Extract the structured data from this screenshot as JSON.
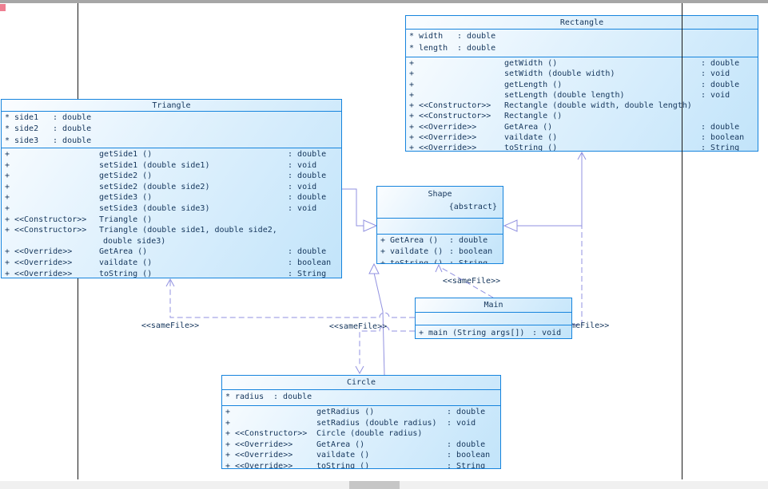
{
  "diagram": {
    "classes": [
      {
        "id": "rectangle",
        "title": "Rectangle",
        "attributes": [
          {
            "vis": "*",
            "name": "width",
            "type": "double"
          },
          {
            "vis": "*",
            "name": "length",
            "type": "double"
          }
        ],
        "methods": [
          {
            "vis": "+",
            "stereo": "",
            "name": "getWidth ()",
            "ret": "double"
          },
          {
            "vis": "+",
            "stereo": "",
            "name": "setWidth (double width)",
            "ret": "void"
          },
          {
            "vis": "+",
            "stereo": "",
            "name": "getLength ()",
            "ret": "double"
          },
          {
            "vis": "+",
            "stereo": "",
            "name": "setLength (double length)",
            "ret": "void"
          },
          {
            "vis": "+",
            "stereo": "<<Constructor>>",
            "name": "Rectangle (double width, double length)",
            "ret": ""
          },
          {
            "vis": "+",
            "stereo": "<<Constructor>>",
            "name": "Rectangle ()",
            "ret": ""
          },
          {
            "vis": "+",
            "stereo": "<<Override>>",
            "name": "GetArea ()",
            "ret": "double"
          },
          {
            "vis": "+",
            "stereo": "<<Override>>",
            "name": "vaildate ()",
            "ret": "boolean"
          },
          {
            "vis": "+",
            "stereo": "<<Override>>",
            "name": "toString ()",
            "ret": "String"
          }
        ]
      },
      {
        "id": "triangle",
        "title": "Triangle",
        "attributes": [
          {
            "vis": "*",
            "name": "side1",
            "type": "double"
          },
          {
            "vis": "*",
            "name": "side2",
            "type": "double"
          },
          {
            "vis": "*",
            "name": "side3",
            "type": "double"
          }
        ],
        "methods": [
          {
            "vis": "+",
            "stereo": "",
            "name": "getSide1 ()",
            "ret": "double"
          },
          {
            "vis": "+",
            "stereo": "",
            "name": "setSide1 (double side1)",
            "ret": "void"
          },
          {
            "vis": "+",
            "stereo": "",
            "name": "getSide2 ()",
            "ret": "double"
          },
          {
            "vis": "+",
            "stereo": "",
            "name": "setSide2 (double side2)",
            "ret": "void"
          },
          {
            "vis": "+",
            "stereo": "",
            "name": "getSide3 ()",
            "ret": "double"
          },
          {
            "vis": "+",
            "stereo": "",
            "name": "setSide3 (double side3)",
            "ret": "void"
          },
          {
            "vis": "+",
            "stereo": "<<Constructor>>",
            "name": "Triangle ()",
            "ret": ""
          },
          {
            "vis": "+",
            "stereo": "<<Constructor>>",
            "name": "Triangle (double side1, double side2,",
            "name2": "double side3)",
            "ret": ""
          },
          {
            "vis": "+",
            "stereo": "<<Override>>",
            "name": "GetArea ()",
            "ret": "double"
          },
          {
            "vis": "+",
            "stereo": "<<Override>>",
            "name": "vaildate ()",
            "ret": "boolean"
          },
          {
            "vis": "+",
            "stereo": "<<Override>>",
            "name": "toString ()",
            "ret": "String"
          }
        ]
      },
      {
        "id": "shape",
        "title": "Shape",
        "note": "{abstract}",
        "attributes": [],
        "methods": [
          {
            "vis": "+",
            "stereo": "",
            "name": "GetArea ()",
            "ret": "double"
          },
          {
            "vis": "+",
            "stereo": "",
            "name": "vaildate ()",
            "ret": "boolean"
          },
          {
            "vis": "+",
            "stereo": "",
            "name": "toString ()",
            "ret": "String"
          }
        ]
      },
      {
        "id": "main",
        "title": "Main",
        "attributes": [],
        "methods": [
          {
            "vis": "+",
            "stereo": "",
            "name": "main (String args[])",
            "ret": "void"
          }
        ]
      },
      {
        "id": "circle",
        "title": "Circle",
        "attributes": [
          {
            "vis": "*",
            "name": "radius",
            "type": "double"
          }
        ],
        "methods": [
          {
            "vis": "+",
            "stereo": "",
            "name": "getRadius ()",
            "ret": "double"
          },
          {
            "vis": "+",
            "stereo": "",
            "name": "setRadius (double radius)",
            "ret": "void"
          },
          {
            "vis": "+",
            "stereo": "<<Constructor>>",
            "name": "Circle (double radius)",
            "ret": ""
          },
          {
            "vis": "+",
            "stereo": "<<Override>>",
            "name": "GetArea ()",
            "ret": "double"
          },
          {
            "vis": "+",
            "stereo": "<<Override>>",
            "name": "vaildate ()",
            "ret": "boolean"
          },
          {
            "vis": "+",
            "stereo": "<<Override>>",
            "name": "toString ()",
            "ret": "String"
          }
        ]
      }
    ],
    "connectors": [
      {
        "type": "dependency",
        "label": "<<sameFile>>",
        "from": "Main",
        "to": "Triangle"
      },
      {
        "type": "dependency",
        "label": "<<sameFile>>",
        "from": "Main",
        "to": "Circle"
      },
      {
        "type": "dependency",
        "label": "<<sameFile>>",
        "from": "Main",
        "to": "Shape"
      },
      {
        "type": "dependency",
        "label": "<<sameFile>>",
        "from": "Main",
        "to": "Rectangle"
      },
      {
        "type": "generalization",
        "label": "",
        "from": "Triangle",
        "to": "Shape"
      },
      {
        "type": "generalization",
        "label": "",
        "from": "Rectangle",
        "to": "Shape"
      },
      {
        "type": "generalization",
        "label": "",
        "from": "Circle",
        "to": "Shape"
      }
    ],
    "colors": {
      "box_border": "#1684dd",
      "box_fill_light": "#fbfdff",
      "box_fill_dark": "#c2e4fa",
      "text": "#14355b",
      "connector": "#9191e0",
      "page_line": "#1a1a1a",
      "top_bar": "#a6a6a6",
      "scrollbar_track": "#f0f0f0",
      "scrollbar_thumb": "#c6c6c6"
    }
  }
}
